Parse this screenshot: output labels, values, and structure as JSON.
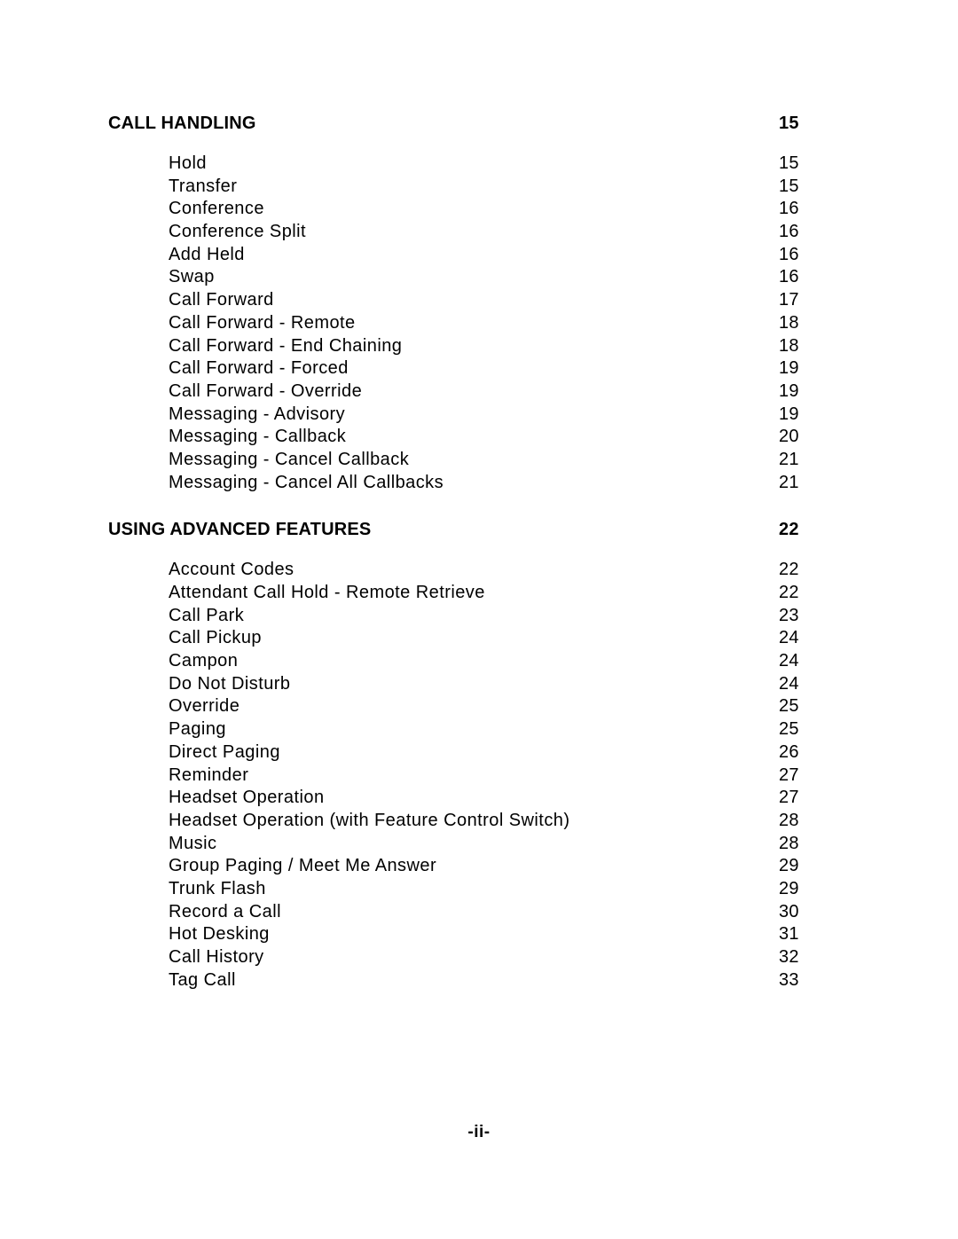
{
  "document": {
    "footer_label": "-ii-"
  },
  "toc": {
    "sections": [
      {
        "title": "CALL HANDLING",
        "page": "15",
        "entries": [
          {
            "title": "Hold",
            "page": "15"
          },
          {
            "title": "Transfer",
            "page": "15"
          },
          {
            "title": "Conference",
            "page": "16"
          },
          {
            "title": "Conference Split",
            "page": "16"
          },
          {
            "title": "Add Held",
            "page": "16"
          },
          {
            "title": "Swap",
            "page": "16"
          },
          {
            "title": "Call Forward",
            "page": "17"
          },
          {
            "title": "Call Forward - Remote",
            "page": "18"
          },
          {
            "title": "Call Forward - End Chaining",
            "page": "18"
          },
          {
            "title": "Call Forward - Forced",
            "page": "19"
          },
          {
            "title": "Call Forward - Override",
            "page": "19"
          },
          {
            "title": "Messaging - Advisory",
            "page": "19"
          },
          {
            "title": "Messaging - Callback",
            "page": "20"
          },
          {
            "title": "Messaging - Cancel Callback",
            "page": "21"
          },
          {
            "title": "Messaging - Cancel All Callbacks",
            "page": "21"
          }
        ]
      },
      {
        "title": "USING ADVANCED FEATURES",
        "page": "22",
        "entries": [
          {
            "title": "Account Codes",
            "page": "22"
          },
          {
            "title": "Attendant Call Hold - Remote Retrieve",
            "page": "22"
          },
          {
            "title": "Call Park",
            "page": "23"
          },
          {
            "title": "Call Pickup",
            "page": "24"
          },
          {
            "title": "Campon",
            "page": "24"
          },
          {
            "title": "Do Not Disturb",
            "page": "24"
          },
          {
            "title": "Override",
            "page": "25"
          },
          {
            "title": "Paging",
            "page": "25"
          },
          {
            "title": "Direct Paging",
            "page": "26"
          },
          {
            "title": "Reminder",
            "page": "27"
          },
          {
            "title": "Headset Operation",
            "page": "27"
          },
          {
            "title": "Headset Operation (with Feature Control Switch)",
            "page": "28"
          },
          {
            "title": "Music",
            "page": "28"
          },
          {
            "title": "Group Paging / Meet Me Answer",
            "page": "29"
          },
          {
            "title": "Trunk Flash",
            "page": "29"
          },
          {
            "title": "Record a Call",
            "page": "30"
          },
          {
            "title": "Hot Desking",
            "page": "31"
          },
          {
            "title": "Call History",
            "page": "32"
          },
          {
            "title": "Tag Call",
            "page": "33"
          }
        ]
      }
    ]
  }
}
